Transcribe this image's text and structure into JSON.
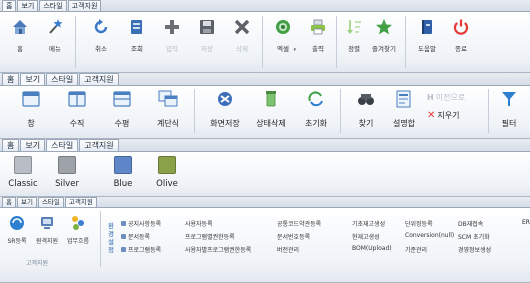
{
  "panel1": {
    "tabs": [
      "홈",
      "보기",
      "스타일",
      "고객지원"
    ],
    "active_tab": 0,
    "buttons": [
      {
        "label": "홈",
        "icon": "home-icon",
        "enabled": true
      },
      {
        "label": "메뉴",
        "icon": "menu-wand-icon",
        "enabled": true
      },
      {
        "label": "취소",
        "icon": "cancel-icon",
        "enabled": true
      },
      {
        "label": "조회",
        "icon": "search-document-icon",
        "enabled": true
      },
      {
        "label": "입력",
        "icon": "add-icon",
        "enabled": false
      },
      {
        "label": "저장",
        "icon": "save-icon",
        "enabled": false
      },
      {
        "label": "삭제",
        "icon": "delete-icon",
        "enabled": false
      },
      {
        "label": "엑셀",
        "icon": "excel-icon",
        "enabled": true
      },
      {
        "label": "출력",
        "icon": "print-icon",
        "enabled": true
      },
      {
        "label": "정렬",
        "icon": "sort-icon",
        "enabled": true
      },
      {
        "label": "즐겨찾기",
        "icon": "star-icon",
        "enabled": true
      },
      {
        "label": "도움말",
        "icon": "help-book-icon",
        "enabled": true
      },
      {
        "label": "종료",
        "icon": "power-icon",
        "enabled": true
      }
    ]
  },
  "panel2": {
    "tabs": [
      "홈",
      "보기",
      "스타일",
      "고객지원"
    ],
    "active_tab": 1,
    "buttons": [
      {
        "label": "창",
        "icon": "window-icon"
      },
      {
        "label": "수직",
        "icon": "tile-vertical-icon"
      },
      {
        "label": "수평",
        "icon": "tile-horizontal-icon"
      },
      {
        "label": "계단식",
        "icon": "cascade-icon"
      },
      {
        "label": "화면저장",
        "icon": "screen-save-icon"
      },
      {
        "label": "상태삭제",
        "icon": "state-delete-icon"
      },
      {
        "label": "초기화",
        "icon": "reset-icon"
      },
      {
        "label": "찾기",
        "icon": "binoculars-icon"
      },
      {
        "label": "설명합",
        "icon": "explain-icon"
      },
      {
        "label": "필터",
        "icon": "filter-icon"
      }
    ],
    "small": {
      "before": "이전으로",
      "clear": "지우기"
    }
  },
  "panel3": {
    "tabs": [
      "홈",
      "보기",
      "스타일",
      "고객지원"
    ],
    "active_tab": 2,
    "styles": [
      {
        "label": "Classic",
        "color": "#b9bec6"
      },
      {
        "label": "Silver",
        "color": "#9ea3aa"
      },
      {
        "label": "Blue",
        "color": "#5f86c8"
      },
      {
        "label": "Olive",
        "color": "#8aa14a"
      }
    ]
  },
  "panel4": {
    "tabs": [
      "홈",
      "보기",
      "스타일",
      "고객지원"
    ],
    "active_tab": 3,
    "buttons": [
      {
        "label": "SR등록",
        "icon": "sr-register-icon"
      },
      {
        "label": "원격지원",
        "icon": "remote-support-icon"
      },
      {
        "label": "업무흐름",
        "icon": "workflow-icon"
      }
    ],
    "group_caption": "고객지원",
    "vertical_label": "환경설정",
    "menu_columns": [
      [
        "공지사항등록",
        "문서등록",
        "프로그램등록"
      ],
      [
        "사용자등록",
        "프로그램별권한등록",
        "사용자별프로그램권한등록"
      ],
      [
        "공통코드약관등록",
        "문서번호등록",
        "버전관리"
      ],
      [
        "기초재고생성",
        "현재고생성",
        "BOM(Upload)"
      ],
      [
        "단위정등록",
        "Conversion(null)",
        "기준관리"
      ],
      [
        "DB재접속",
        "SCM 초기화",
        "경영정보생성"
      ]
    ],
    "overflow_label": "ER"
  }
}
